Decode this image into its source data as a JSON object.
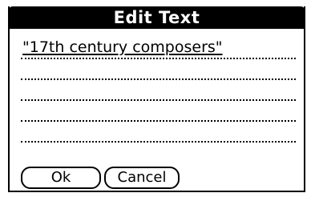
{
  "dialog": {
    "title": "Edit Text",
    "text_lines": [
      "\"17th century composers\"",
      "",
      "",
      "",
      ""
    ],
    "buttons": {
      "ok_label": "Ok",
      "cancel_label": "Cancel"
    }
  },
  "colors": {
    "title_bar_background": "#000000",
    "title_text": "#ffffff",
    "dialog_background": "#ffffff",
    "border": "#000000"
  }
}
